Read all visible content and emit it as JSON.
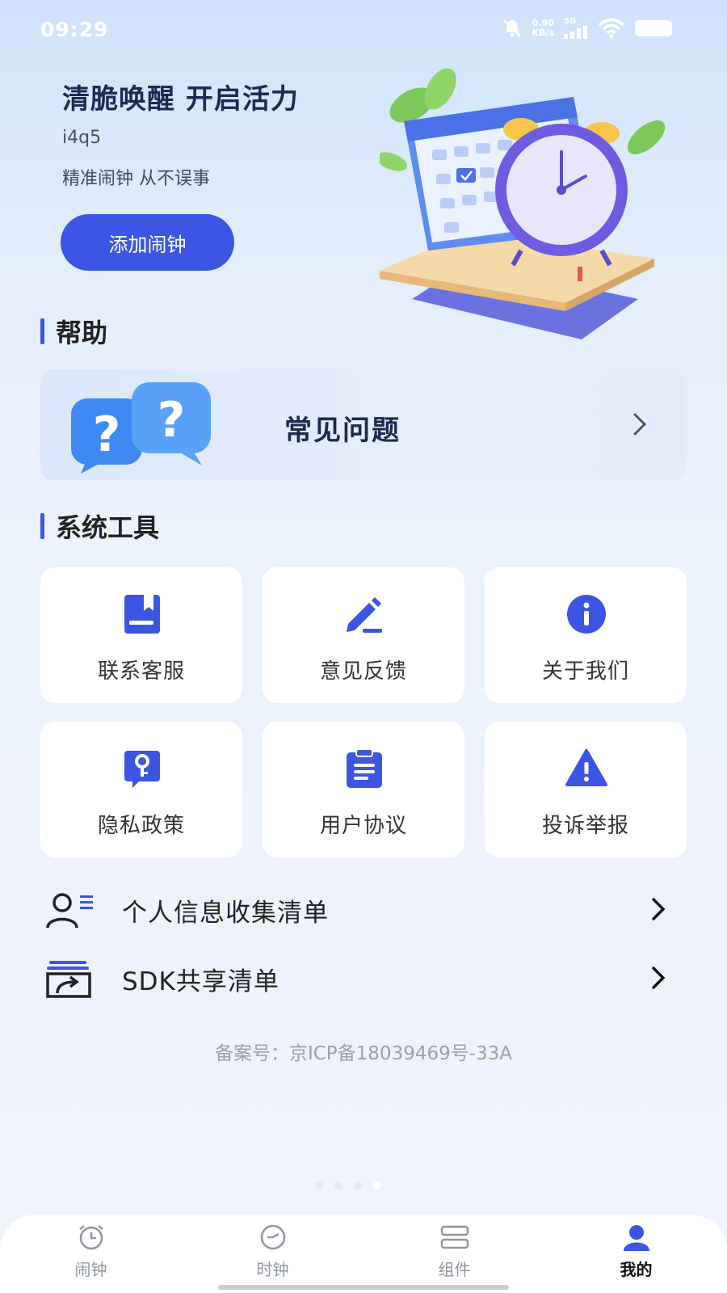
{
  "status_bar": {
    "time": "09:29",
    "net_speed_value": "0.90",
    "net_speed_unit": "KB/s",
    "network": "5G",
    "icons": [
      "mute-bell-icon",
      "signal-icon",
      "wifi-icon",
      "battery-icon"
    ]
  },
  "hero": {
    "title": "清脆唤醒 开启活力",
    "code": "i4q5",
    "subtitle": "精准闹钟 从不误事",
    "add_button": "添加闹钟",
    "illustration": "calendar-alarm-clock-illustration"
  },
  "help": {
    "section_title": "帮助",
    "faq_label": "常见问题",
    "faq_icon": "question-bubbles-icon"
  },
  "tools": {
    "section_title": "系统工具",
    "items": [
      {
        "label": "联系客服",
        "icon": "book-icon"
      },
      {
        "label": "意见反馈",
        "icon": "pencil-icon"
      },
      {
        "label": "关于我们",
        "icon": "info-icon"
      },
      {
        "label": "隐私政策",
        "icon": "key-icon"
      },
      {
        "label": "用户协议",
        "icon": "clipboard-icon"
      },
      {
        "label": "投诉举报",
        "icon": "warning-icon"
      }
    ]
  },
  "lists": [
    {
      "label": "个人信息收集清单",
      "icon": "user-list-icon"
    },
    {
      "label": "SDK共享清单",
      "icon": "share-box-icon"
    }
  ],
  "icp": "备案号：京ICP备18039469号-33A",
  "page_indicator": {
    "count": 4,
    "active_index": 3
  },
  "tabbar": {
    "tabs": [
      {
        "label": "闹钟",
        "icon": "alarm-clock-icon"
      },
      {
        "label": "时钟",
        "icon": "clock-icon"
      },
      {
        "label": "组件",
        "icon": "widgets-icon"
      },
      {
        "label": "我的",
        "icon": "profile-icon"
      }
    ],
    "active_index": 3
  },
  "colors": {
    "accent": "#3c55e4",
    "title": "#1d2a54",
    "muted": "#9aa0ac"
  }
}
